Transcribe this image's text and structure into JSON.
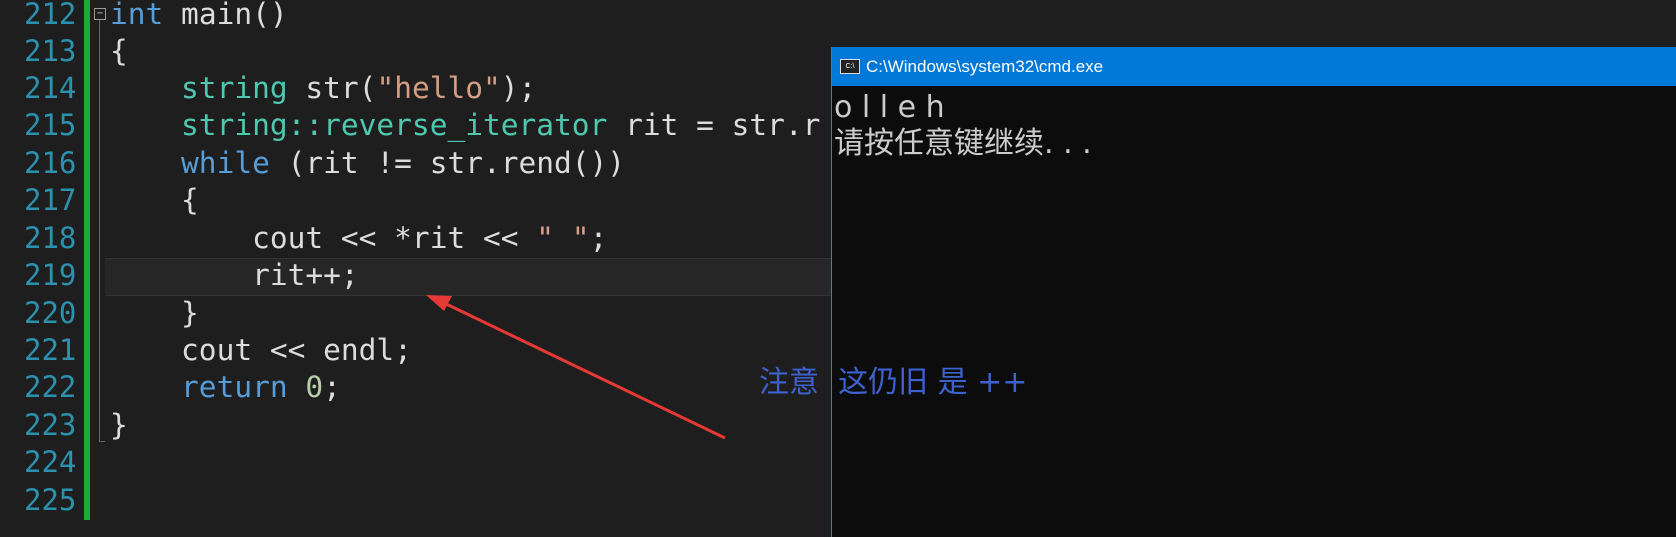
{
  "editor": {
    "line_numbers": [
      "212",
      "213",
      "214",
      "215",
      "216",
      "217",
      "218",
      "219",
      "220",
      "221",
      "222",
      "223",
      "224",
      "225"
    ],
    "current_line": "219"
  },
  "console": {
    "title": "C:\\Windows\\system32\\cmd.exe",
    "output": [
      "o l l e h",
      "请按任意键继续. . ."
    ]
  },
  "annotation": {
    "text": "注意  这仍旧 是 ++",
    "color": "#3d62d0",
    "arrow_color": "#e53935"
  },
  "code": {
    "l212": [
      "int",
      " main()"
    ],
    "l213": "{",
    "l214": [
      "    ",
      "string",
      " str(",
      "\"hello\"",
      ");"
    ],
    "l215": [
      "    ",
      "string::reverse_iterator",
      " rit = str.r"
    ],
    "l216": [
      "    ",
      "while",
      " (rit != str.rend())"
    ],
    "l217": "    {",
    "l218": [
      "        cout << *rit << ",
      "\" \"",
      ";"
    ],
    "l219": "        rit++;",
    "l220": "    }",
    "l221": "    cout << endl;",
    "l222": [
      "    ",
      "return",
      " ",
      "0",
      ";"
    ],
    "l223": "}"
  }
}
